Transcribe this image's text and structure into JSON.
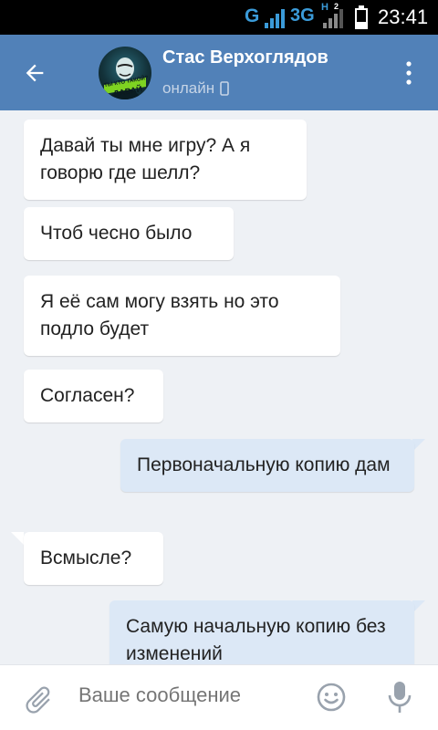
{
  "status_bar": {
    "network1": "G",
    "network2": "3G",
    "network2_sub": "H",
    "sim_badge": "2",
    "time": "23:41"
  },
  "header": {
    "title": "Стас Верхоглядов",
    "subtitle": "онлайн",
    "avatar_text_top": "ТЫ КТО ТАКОЙ?",
    "avatar_text_bottom": "ДАВАЙ"
  },
  "messages": [
    {
      "direction": "in",
      "text": "Давай ты мне игру? А я говорю где шелл?"
    },
    {
      "direction": "in",
      "text": "Чтоб чесно было"
    },
    {
      "direction": "in",
      "text": "Я её сам могу взять но это подло будет"
    },
    {
      "direction": "in",
      "text": "Согласен?"
    },
    {
      "direction": "out",
      "text": "Первоначальную копию дам"
    },
    {
      "direction": "in",
      "text": "Всмысле?"
    },
    {
      "direction": "out",
      "text": "Самую начальную копию без изменений"
    }
  ],
  "composer": {
    "placeholder": "Ваше сообщение"
  },
  "colors": {
    "header_bg": "#5181b8",
    "chat_bg": "#eef1f5",
    "incoming_bubble": "#ffffff",
    "outgoing_bubble": "#dce8f6",
    "status_network": "#3b9bd9"
  },
  "icons": {
    "back": "arrow-left-icon",
    "more": "more-vertical-icon",
    "online_device": "phone-icon",
    "attach": "paperclip-icon",
    "emoji": "smile-icon",
    "mic": "microphone-icon"
  }
}
